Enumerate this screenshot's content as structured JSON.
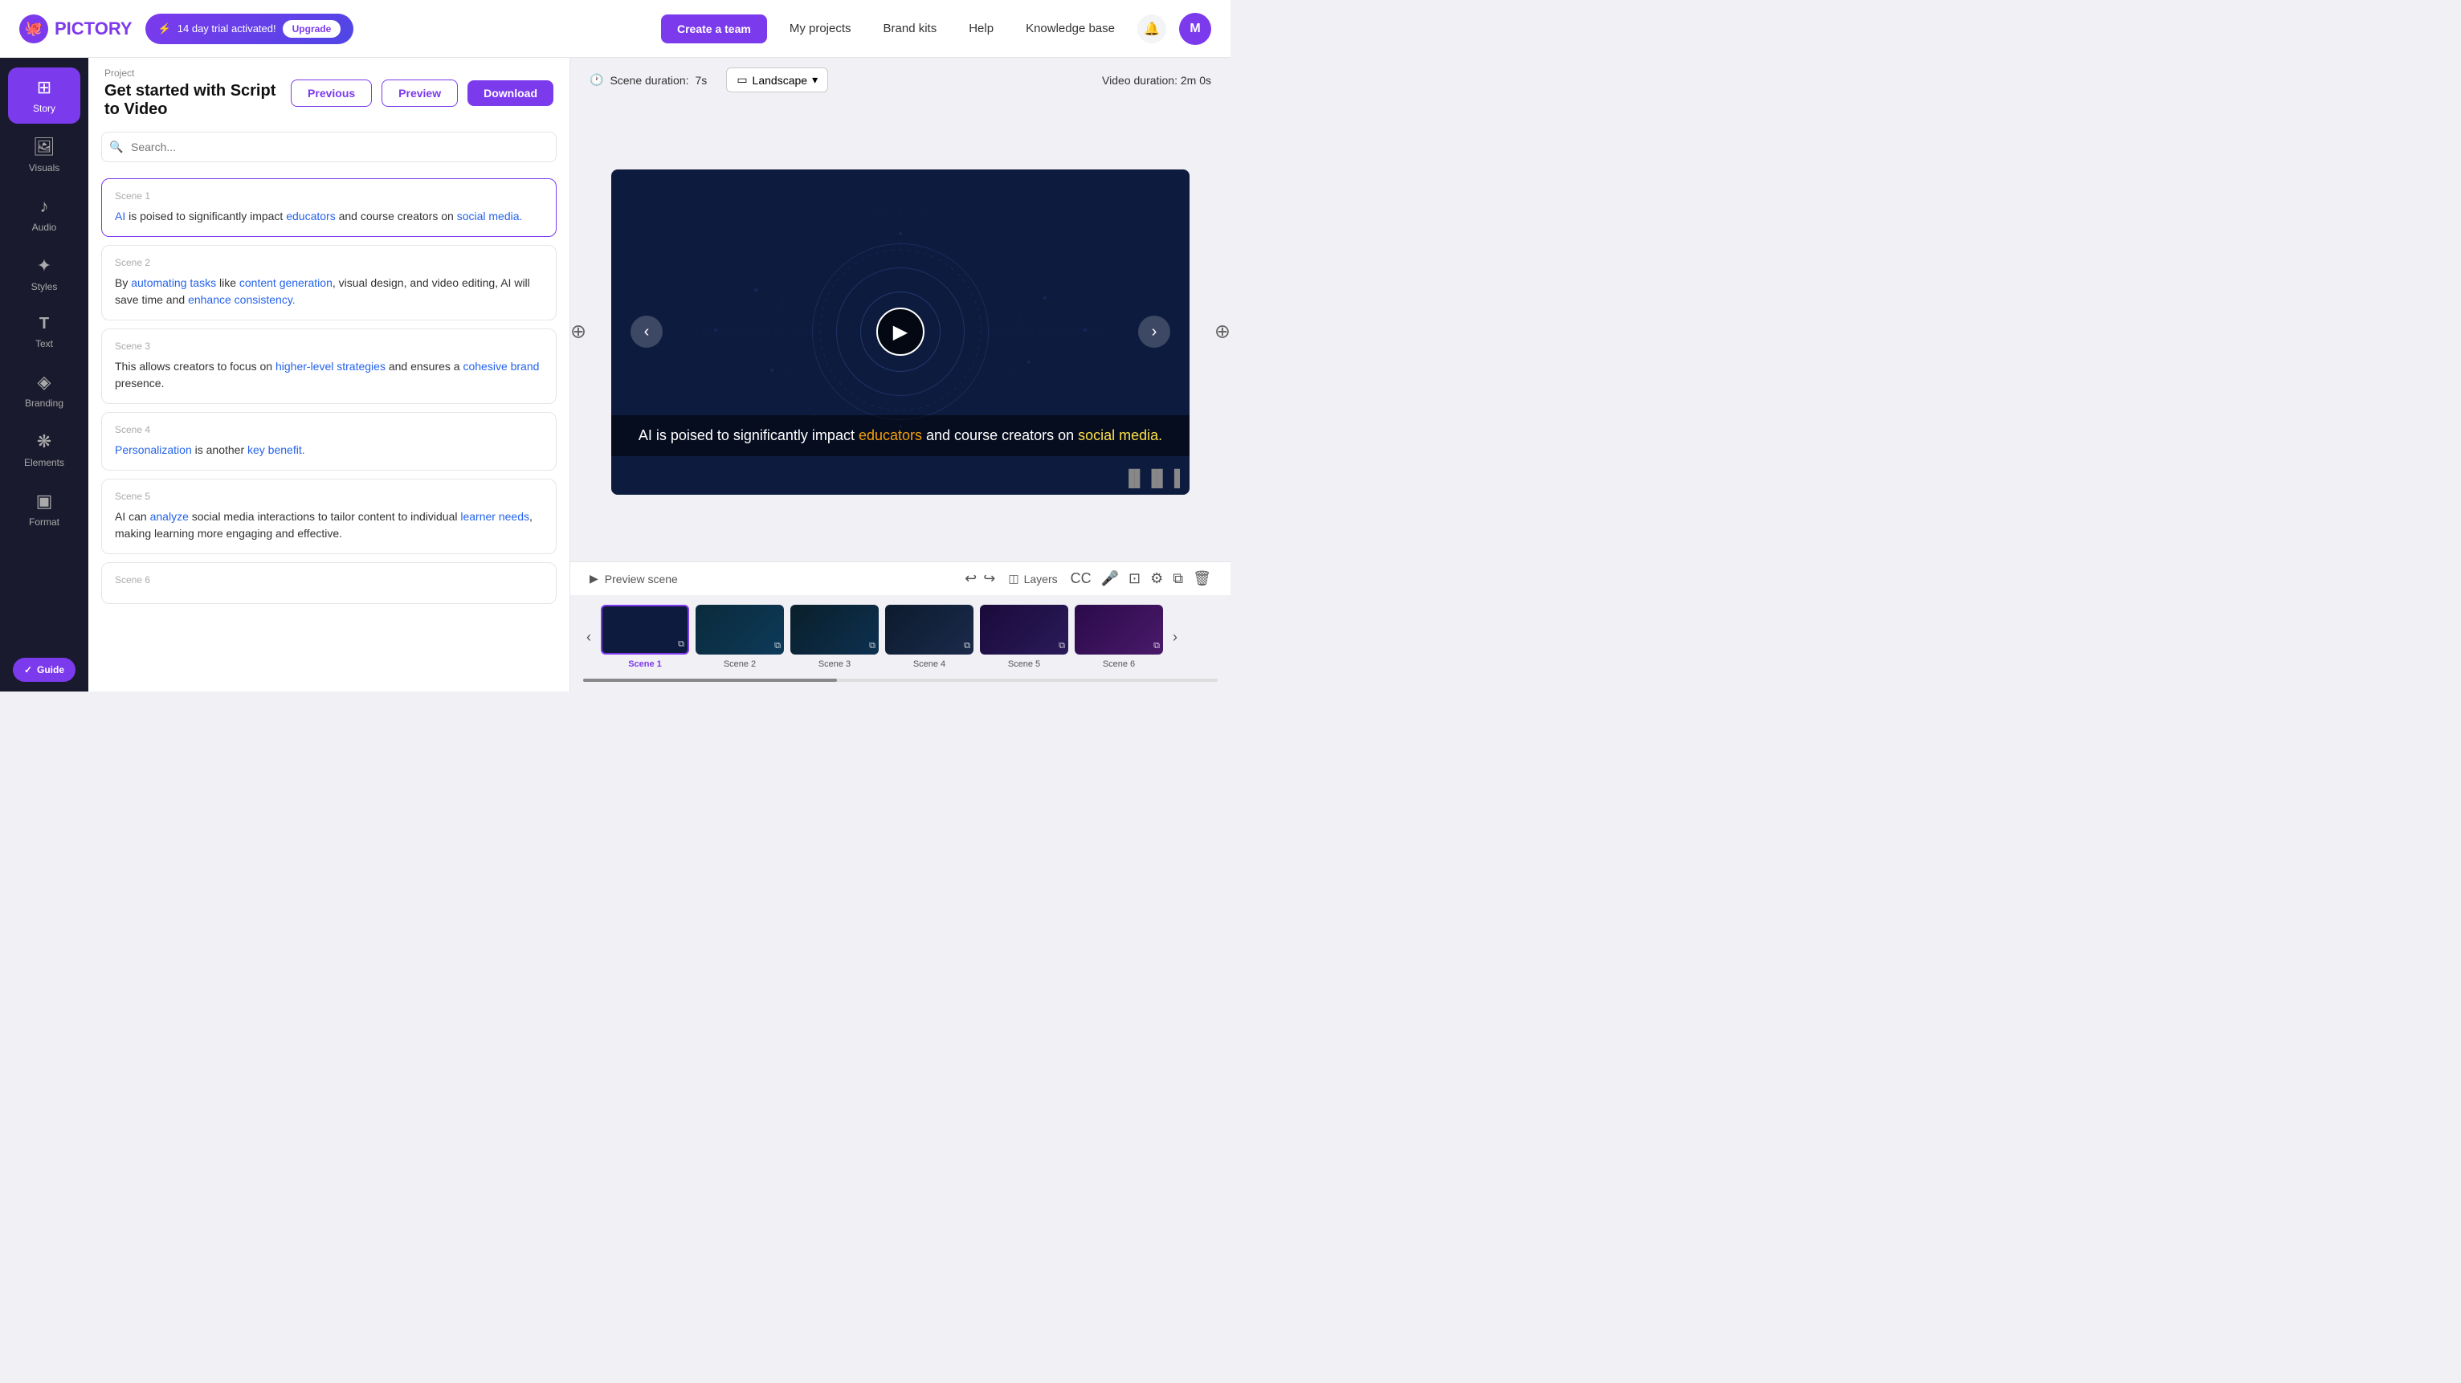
{
  "app": {
    "logo_text": "PICTORY",
    "trial_text": "14 day trial activated!",
    "upgrade_label": "Upgrade",
    "create_team_label": "Create a team",
    "nav_links": [
      "My projects",
      "Brand kits",
      "Help",
      "Knowledge base"
    ],
    "avatar_letter": "M"
  },
  "sidebar": {
    "items": [
      {
        "id": "story",
        "label": "Story",
        "icon": "⊞",
        "active": true
      },
      {
        "id": "visuals",
        "label": "Visuals",
        "icon": "🖼",
        "active": false
      },
      {
        "id": "audio",
        "label": "Audio",
        "icon": "🎵",
        "active": false
      },
      {
        "id": "styles",
        "label": "Styles",
        "icon": "✦",
        "active": false
      },
      {
        "id": "text",
        "label": "Text",
        "icon": "T",
        "active": false
      },
      {
        "id": "branding",
        "label": "Branding",
        "icon": "◈",
        "active": false
      },
      {
        "id": "elements",
        "label": "Elements",
        "icon": "❋",
        "active": false
      },
      {
        "id": "format",
        "label": "Format",
        "icon": "▣",
        "active": false
      }
    ],
    "guide_label": "Guide"
  },
  "header": {
    "project_label": "Project",
    "project_title": "Get started with Script to Video",
    "previous_label": "Previous",
    "preview_label": "Preview",
    "download_label": "Download"
  },
  "search": {
    "placeholder": "Search..."
  },
  "scenes": [
    {
      "id": 1,
      "label": "Scene 1",
      "text": "AI is poised to significantly impact educators and course creators on social media.",
      "links": [
        {
          "word": "AI",
          "type": "blue",
          "pos": 0
        },
        {
          "word": "educators",
          "type": "blue"
        },
        {
          "word": "social media.",
          "type": "blue"
        }
      ],
      "active": true
    },
    {
      "id": 2,
      "label": "Scene 2",
      "text": "By automating tasks like content generation, visual design, and video editing, AI will save time and enhance consistency.",
      "links": [
        {
          "word": "automating tasks",
          "type": "blue"
        },
        {
          "word": "content generation",
          "type": "blue"
        },
        {
          "word": "enhance consistency.",
          "type": "blue"
        }
      ]
    },
    {
      "id": 3,
      "label": "Scene 3",
      "text": "This allows creators to focus on higher-level strategies and ensures a cohesive brand presence.",
      "links": [
        {
          "word": "higher-level strategies",
          "type": "blue"
        },
        {
          "word": "cohesive brand",
          "type": "blue"
        }
      ]
    },
    {
      "id": 4,
      "label": "Scene 4",
      "text": "Personalization is another key benefit.",
      "links": [
        {
          "word": "Personalization",
          "type": "blue"
        },
        {
          "word": "key benefit.",
          "type": "blue"
        }
      ]
    },
    {
      "id": 5,
      "label": "Scene 5",
      "text": "AI can analyze social media interactions to tailor content to individual learner needs, making learning more engaging and effective.",
      "links": [
        {
          "word": "analyze",
          "type": "blue"
        },
        {
          "word": "learner needs",
          "type": "blue"
        }
      ]
    },
    {
      "id": 6,
      "label": "Scene 6",
      "text": ""
    }
  ],
  "video": {
    "scene_duration_label": "Scene duration:",
    "scene_duration_value": "7s",
    "landscape_label": "Landscape",
    "video_duration_label": "Video duration:",
    "video_duration_value": "2m 0s",
    "subtitle_text": "AI is poised to significantly impact",
    "subtitle_highlight1": "educators",
    "subtitle_text2": "and course creators on",
    "subtitle_highlight2": "social media.",
    "preview_scene_label": "Preview scene",
    "layers_label": "Layers"
  },
  "timeline": {
    "scenes": [
      {
        "label": "Scene 1",
        "active": true,
        "bg_color": "#0d1b3e"
      },
      {
        "label": "Scene 2",
        "active": false,
        "bg_color": "#0a2a3a"
      },
      {
        "label": "Scene 3",
        "active": false,
        "bg_color": "#0a1f35"
      },
      {
        "label": "Scene 4",
        "active": false,
        "bg_color": "#0d1b2e"
      },
      {
        "label": "Scene 5",
        "active": false,
        "bg_color": "#1a0a3a"
      },
      {
        "label": "Scene 6",
        "active": false,
        "bg_color": "#2a0a4a"
      }
    ]
  }
}
